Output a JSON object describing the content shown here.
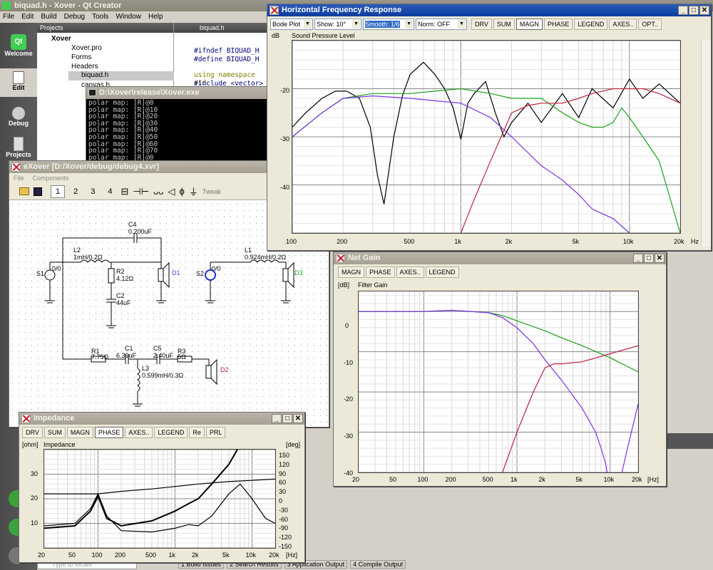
{
  "qt": {
    "title": "biquad.h - Xover - Qt Creator",
    "menu": [
      "File",
      "Edit",
      "Build",
      "Debug",
      "Tools",
      "Window",
      "Help"
    ],
    "modes": [
      "Welcome",
      "Edit",
      "Debug",
      "Projects"
    ],
    "projects_label": "Projects",
    "file_tab": "biquad.h",
    "tree": [
      "Xover",
      "Xover.pro",
      "Forms",
      "Headers",
      "biquad.h",
      "canvas.h"
    ],
    "code": [
      "#ifndef BIQUAD_H",
      "#define BIQUAD_H",
      "",
      "using namespace std",
      "#include <vector>"
    ],
    "bottom": {
      "locate": "Type to locate",
      "tabs": [
        "1  Build Issues",
        "2  Search Results",
        "3  Application Output",
        "4  Compile Output"
      ]
    }
  },
  "console": {
    "title": "D:\\Xover\\release\\Xover.exe",
    "lines": [
      "polar map: [R]@0",
      "polar map: [R]@10",
      "polar map: [R]@20",
      "polar map: [R]@30",
      "polar map: [R]@40",
      "polar map: [R]@50",
      "polar map: [R]@60",
      "polar map: [R]@70",
      "polar map: [R]@0"
    ]
  },
  "exover": {
    "title": "eXover [D:/Xover/debug/debug4.xvr]",
    "menu": [
      "File",
      "Components"
    ],
    "pages": [
      "1",
      "2",
      "3",
      "4"
    ],
    "tweak": "Tweak",
    "comps": {
      "c4": "C4",
      "c4v": "0.200uF",
      "l2": "L2",
      "l2v": "1mH/0.2Ω",
      "s1": "S1",
      "r2": "R2",
      "r2v": "4.12Ω",
      "c2": "C2",
      "c2v": "44uF",
      "d1": "D1",
      "s2": "S2",
      "l1": "L1",
      "l1v": "0.924mH/0.2Ω",
      "d3": "D3",
      "r1": "R1",
      "r1v": "7.75Ω",
      "c1": "C1",
      "c1v": "6.39uF",
      "c5": "C5",
      "c5v": "2.40uF",
      "r3": "R3",
      "r3v": "5Ω",
      "l3": "L3",
      "l3v": "0.599mH/0.3Ω",
      "d2": "D2",
      "zero": "0/0"
    }
  },
  "hfr": {
    "title": "Horizontal Frequency Response",
    "plot_type": "Bode Plot",
    "show": "Show: 10°",
    "smooth": "Smooth: 1/6",
    "norm": "Norm: OFF",
    "tabs": [
      "DRV",
      "SUM",
      "MAGN",
      "PHASE",
      "LEGEND",
      "AXES..",
      "OPT.."
    ],
    "active": "MAGN",
    "unit": "dB",
    "subtitle": "Sound Pressure Level",
    "yticks": [
      "-20",
      "-30",
      "-40"
    ],
    "xticks": [
      "100",
      "200",
      "500",
      "1k",
      "2k",
      "5k",
      "10k",
      "20k"
    ],
    "xunit": "Hz"
  },
  "net": {
    "title": "Net Gain",
    "tabs": [
      "MAGN",
      "PHASE",
      "AXES..",
      "LEGEND"
    ],
    "unit": "[dB]",
    "subtitle": "Filter Gain",
    "yticks": [
      "0",
      "-10",
      "-20",
      "-30",
      "-40"
    ],
    "xticks": [
      "20",
      "50",
      "100",
      "200",
      "500",
      "1k",
      "2k",
      "5k",
      "10k",
      "20k"
    ],
    "xunit": "[Hz]"
  },
  "imp": {
    "title": "Impedance",
    "tabs": [
      "DRV",
      "SUM",
      "MAGN",
      "PHASE",
      "AXES..",
      "LEGEND",
      "Re",
      "PRL"
    ],
    "active": "PHASE",
    "unit": "[ohm]",
    "unit2": "[deg]",
    "subtitle": "Impedance",
    "yticks": [
      "30",
      "20",
      "10"
    ],
    "y2ticks": [
      "150",
      "120",
      "90",
      "60",
      "30",
      "0",
      "-30",
      "-60",
      "-90",
      "-120",
      "-150"
    ],
    "xticks": [
      "20",
      "50",
      "100",
      "200",
      "500",
      "1k",
      "2k",
      "5k",
      "10k",
      "20k"
    ],
    "xunit": "[Hz]"
  },
  "colors": {
    "black": "#000000",
    "green": "#1aa01a",
    "purple": "#7b2fe8",
    "red": "#c0223a",
    "brown": "#6b2a1a",
    "blue": "#1a2fd8"
  },
  "chart_data": [
    {
      "type": "line",
      "title": "Sound Pressure Level",
      "ylabel": "dB",
      "xlim": [
        100,
        20000
      ],
      "ylim": [
        -50,
        -10
      ],
      "xscale": "log",
      "series": [
        {
          "color": "black",
          "x": [
            100,
            120,
            150,
            180,
            210,
            250,
            290,
            320,
            350,
            400,
            450,
            500,
            600,
            700,
            800,
            900,
            1000,
            1100,
            1200,
            1400,
            1600,
            1800,
            2000,
            2500,
            3000,
            4000,
            5000,
            6000,
            8000,
            10000,
            12000,
            15000,
            20000
          ],
          "y": [
            -28,
            -25,
            -22,
            -20.5,
            -20.5,
            -22,
            -28,
            -38,
            -44,
            -30,
            -21.5,
            -17,
            -14.5,
            -17,
            -20,
            -24,
            -30.5,
            -23,
            -21,
            -18.5,
            -25,
            -30,
            -27,
            -23,
            -27,
            -21,
            -26,
            -20,
            -24,
            -18,
            -22,
            -19,
            -23
          ]
        },
        {
          "color": "green",
          "x": [
            100,
            150,
            200,
            300,
            500,
            700,
            1000,
            1500,
            2000,
            3000,
            4000,
            5000,
            6000,
            7000,
            8000,
            9000,
            10000,
            12000,
            15000,
            20000
          ],
          "y": [
            -30,
            -25,
            -22,
            -21,
            -21,
            -20.5,
            -20,
            -21,
            -22,
            -22,
            -25,
            -27,
            -28,
            -28,
            -27,
            -24,
            -26,
            -30,
            -35,
            -50
          ]
        },
        {
          "color": "purple",
          "x": [
            100,
            150,
            200,
            300,
            500,
            700,
            1000,
            1500,
            2000,
            3000,
            4000,
            5000,
            6000,
            8000,
            10000
          ],
          "y": [
            -30,
            -25,
            -22,
            -21.5,
            -22,
            -22.5,
            -23,
            -26,
            -30,
            -36,
            -39,
            -42,
            -45,
            -47,
            -50
          ]
        },
        {
          "color": "red",
          "x": [
            1000,
            1200,
            1500,
            2000,
            2500,
            3000,
            4000,
            5000,
            6000,
            8000,
            10000,
            12000,
            15000,
            20000
          ],
          "y": [
            -50,
            -43,
            -35,
            -25,
            -23.5,
            -23,
            -23,
            -22,
            -21,
            -20,
            -20,
            -20,
            -21,
            -23
          ]
        }
      ]
    },
    {
      "type": "line",
      "title": "Filter Gain",
      "ylabel": "[dB]",
      "xlim": [
        20,
        20000
      ],
      "ylim": [
        -40,
        5
      ],
      "xscale": "log",
      "series": [
        {
          "color": "green",
          "x": [
            20,
            100,
            200,
            500,
            700,
            1000,
            2000,
            3000,
            5000,
            10000,
            20000
          ],
          "y": [
            0,
            0,
            0.3,
            -0.3,
            -1,
            -2.3,
            -4.8,
            -6.5,
            -8.5,
            -11.5,
            -15
          ]
        },
        {
          "color": "purple",
          "x": [
            20,
            100,
            200,
            500,
            700,
            1000,
            1500,
            2000,
            3000,
            5000,
            7000,
            8000,
            9000,
            10000,
            12000,
            15000,
            20000
          ],
          "y": [
            0,
            0,
            0.3,
            -0.3,
            -1.5,
            -4,
            -8,
            -12,
            -17,
            -24,
            -30,
            -34,
            -38,
            -50,
            -50,
            -35,
            -23
          ]
        },
        {
          "color": "red",
          "x": [
            700,
            1000,
            1500,
            2000,
            2500,
            3000,
            5000,
            10000,
            20000
          ],
          "y": [
            -40,
            -30,
            -20,
            -14,
            -13,
            -13,
            -12.5,
            -10.5,
            -8.5
          ]
        }
      ]
    },
    {
      "type": "line",
      "title": "Impedance",
      "ylabel": "[ohm]",
      "xlim": [
        20,
        20000
      ],
      "ylim": [
        0,
        40
      ],
      "xscale": "log",
      "series": [
        {
          "color": "black",
          "x": [
            20,
            50,
            80,
            100,
            130,
            200,
            500,
            1000,
            1500,
            2000,
            3000,
            5000,
            7000,
            10000,
            15000,
            20000
          ],
          "y": [
            9,
            10,
            16,
            22,
            13,
            7,
            6.5,
            8,
            9.5,
            9,
            13,
            22,
            26,
            20,
            12,
            10
          ]
        },
        {
          "color": "black",
          "x": [
            20,
            50,
            80,
            100,
            130,
            200,
            500,
            1000,
            1500,
            2000,
            3000,
            5000,
            7000,
            10000
          ],
          "y": [
            8,
            9,
            15,
            21,
            12,
            9,
            11,
            15,
            18,
            20,
            26,
            34,
            42,
            48
          ]
        },
        {
          "color": "black",
          "x": [
            20,
            50,
            100,
            200,
            500,
            1000,
            2000,
            5000,
            10000,
            20000
          ],
          "y": [
            22,
            22,
            22,
            23,
            24,
            25,
            26,
            27,
            27.5,
            28
          ]
        }
      ]
    }
  ]
}
